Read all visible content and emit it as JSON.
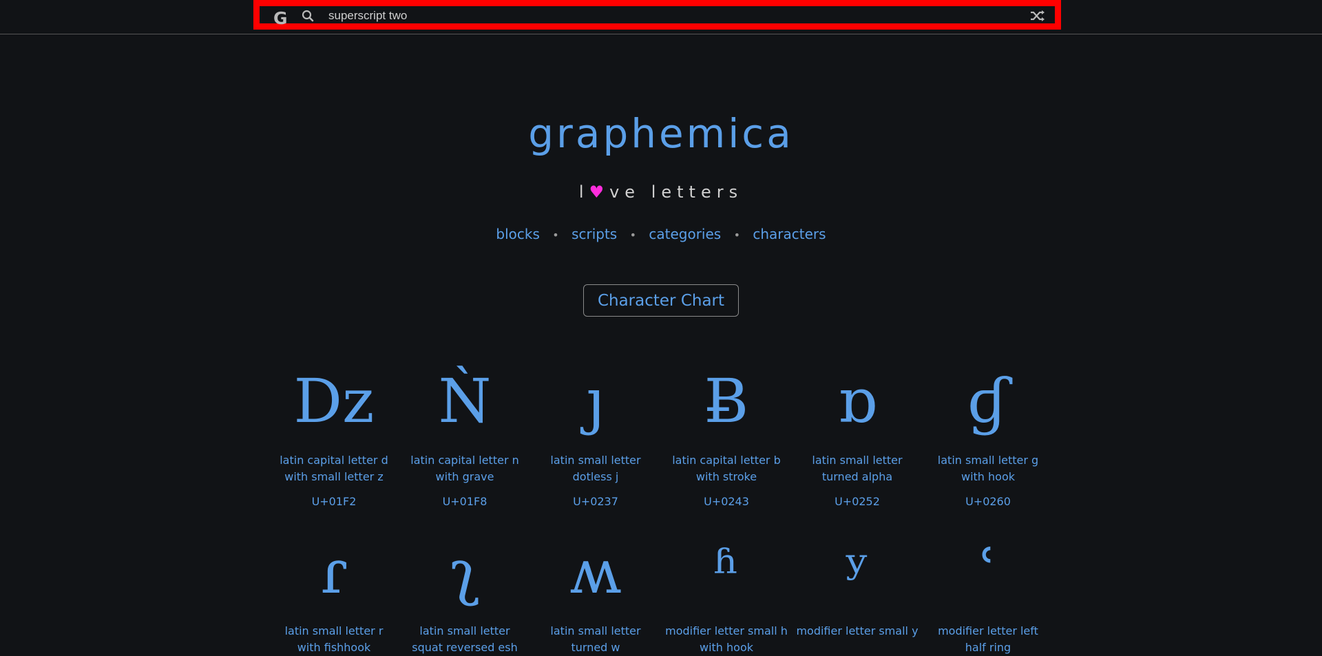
{
  "header": {
    "logo": "G",
    "search_value": "superscript two",
    "search_icon": "search-icon",
    "shuffle_icon": "shuffle-icon"
  },
  "hero": {
    "title": "graphemica",
    "tagline_prefix": "l",
    "tagline_heart": "♥",
    "tagline_suffix": "ve letters"
  },
  "nav": {
    "items": [
      {
        "label": "blocks"
      },
      {
        "label": "scripts"
      },
      {
        "label": "categories"
      },
      {
        "label": "characters"
      }
    ],
    "separator": "•"
  },
  "chart_button": {
    "label": "Character Chart"
  },
  "characters": [
    {
      "glyph": "ǲ",
      "name": "latin capital letter d with small letter z",
      "code": "U+01F2"
    },
    {
      "glyph": "Ǹ",
      "name": "latin capital letter n with grave",
      "code": "U+01F8"
    },
    {
      "glyph": "ȷ",
      "name": "latin small letter dotless j",
      "code": "U+0237"
    },
    {
      "glyph": "Ƀ",
      "name": "latin capital letter b with stroke",
      "code": "U+0243"
    },
    {
      "glyph": "ɒ",
      "name": "latin small letter turned alpha",
      "code": "U+0252"
    },
    {
      "glyph": "ɠ",
      "name": "latin small letter g with hook",
      "code": "U+0260"
    },
    {
      "glyph": "ɾ",
      "name": "latin small letter r with fishhook",
      "code": ""
    },
    {
      "glyph": "ʅ",
      "name": "latin small letter squat reversed esh",
      "code": ""
    },
    {
      "glyph": "ʍ",
      "name": "latin small letter turned w",
      "code": ""
    },
    {
      "glyph": "ʱ",
      "name": "modifier letter small h with hook",
      "code": ""
    },
    {
      "glyph": "ʸ",
      "name": "modifier letter small y",
      "code": ""
    },
    {
      "glyph": "ʿ",
      "name": "modifier letter left half ring",
      "code": ""
    }
  ]
}
